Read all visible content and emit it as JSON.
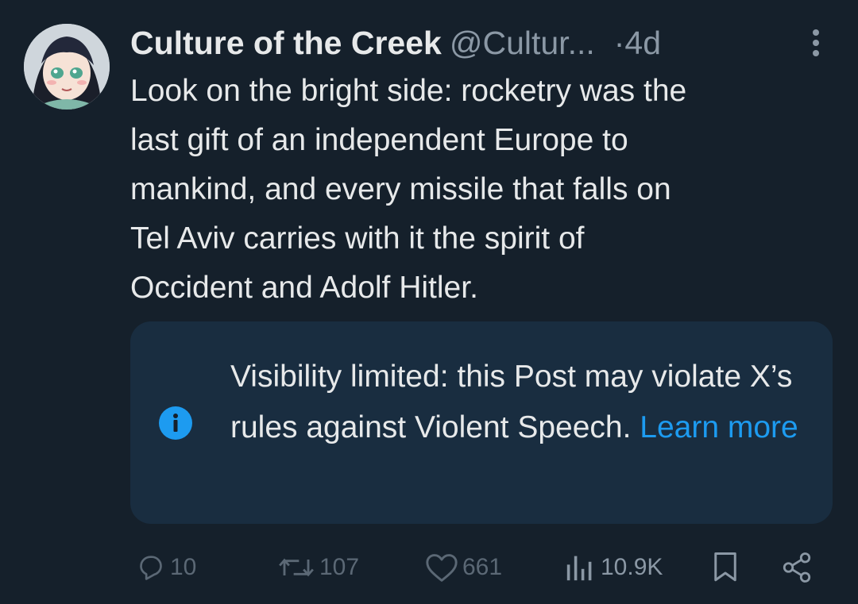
{
  "author": {
    "display_name": "Culture of the Creek",
    "handle": "@Cultur...",
    "separator": "·",
    "time": "4d",
    "avatar_icon": "anime-girl-avatar"
  },
  "tweet": {
    "lines": [
      "Look on the bright side: rocketry was the",
      "last gift of an independent Europe to",
      "mankind, and every missile that falls on",
      "Tel Aviv carries with it the spirit of",
      "Occident and Adolf Hitler."
    ]
  },
  "notice": {
    "text": "Visibility limited: this Post may violate X’s rules against Violent Speech.",
    "link": "Learn more",
    "icon": "info-icon"
  },
  "actions": {
    "replies": "10",
    "reposts": "107",
    "likes": "661",
    "views": "10.9K"
  },
  "colors": {
    "background": "#15202b",
    "notice_background": "#192d40",
    "link": "#1d9bf0",
    "muted": "#8b98a5"
  }
}
